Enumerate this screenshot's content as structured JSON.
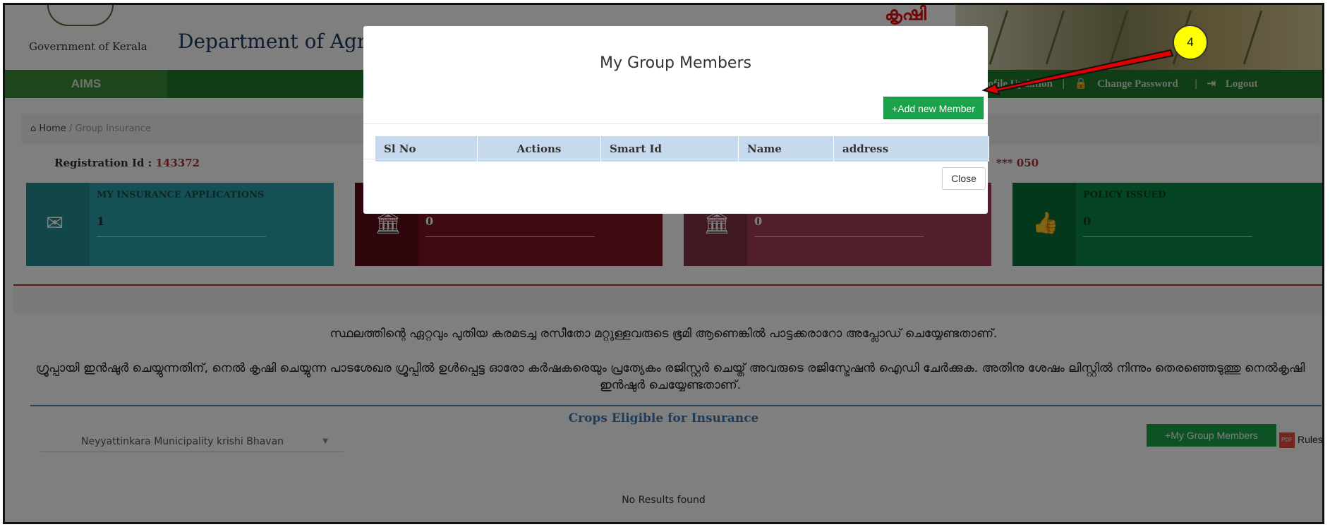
{
  "header": {
    "gov_label": "Government of Kerala",
    "dept_label": "Department of Agric",
    "logo_text": "കൃഷി"
  },
  "nav": {
    "brand": "AIMS",
    "profile": "Profile Updation",
    "change_password": "Change Password",
    "logout": "Logout",
    "sep": "|"
  },
  "breadcrumb": {
    "home": "Home",
    "sep": "/",
    "current": "Group Insurance"
  },
  "registration": {
    "label": "Registration Id :",
    "value": "143372",
    "right_value": "*** 050"
  },
  "cards": [
    {
      "label": "MY INSURANCE APPLICATIONS",
      "value": "1",
      "color": "#2aa3a8"
    },
    {
      "label": "",
      "value": "0",
      "color": "#a11b2c"
    },
    {
      "label": "",
      "value": "0",
      "color": "#c4506a"
    },
    {
      "label": "POLICY ISSUED",
      "value": "0",
      "color": "#0a8a4a"
    }
  ],
  "notices": {
    "line1": "സ്ഥലത്തിന്റെ ഏറ്റവും പുതിയ കരമടച്ച രസീതോ മറ്റുള്ളവരുടെ ഭൂമി ആണെങ്കിൽ പാട്ടക്കരാറോ അപ്ലോഡ് ചെയ്യേണ്ടതാണ്.",
    "line2": "ഗ്രൂപ്പായി ഇൻഷുർ ചെയ്യുന്നതിന്, നെൽ കൃഷി ചെയ്യുന്ന പാടശേഖര ഗ്രൂപ്പിൽ ഉൾപ്പെട്ട ഓരോ കർഷകരെയും പ്രത്യേകം രജിസ്റ്റർ ചെയ്ത് അവരുടെ രജിസ്ട്രേഷൻ ഐഡി ചേർക്കുക. അതിനു ശേഷം ലിസ്റ്റിൽ നിന്നും തെരഞ്ഞെടുത്തു നെൽകൃഷി ഇൻഷുർ ചെയ്യേണ്ടതാണ്."
  },
  "crops": {
    "title": "Crops Eligible for Insurance",
    "select_value": "Neyyattinkara Municipality krishi Bhavan",
    "group_btn": "My Group Members",
    "rules": "Rules",
    "empty": "No Results found"
  },
  "modal": {
    "title": "My Group Members",
    "add_btn": "Add new Member",
    "columns": [
      "Sl No",
      "Actions",
      "Smart Id",
      "Name",
      "address"
    ],
    "close": "Close"
  },
  "annotation": {
    "step": "4"
  },
  "colors": {
    "accent_green": "#1aa34a",
    "nav_green": "#1e7a2c",
    "table_header": "#c7d9ec",
    "callout_yellow": "#ffff00",
    "arrow_red": "#e00000"
  },
  "icons": [
    "home-icon",
    "envelope-icon",
    "bank-icon",
    "thumbs-up-icon",
    "plus-icon",
    "lock-icon",
    "logout-icon",
    "pdf-icon",
    "caret-down-icon"
  ]
}
